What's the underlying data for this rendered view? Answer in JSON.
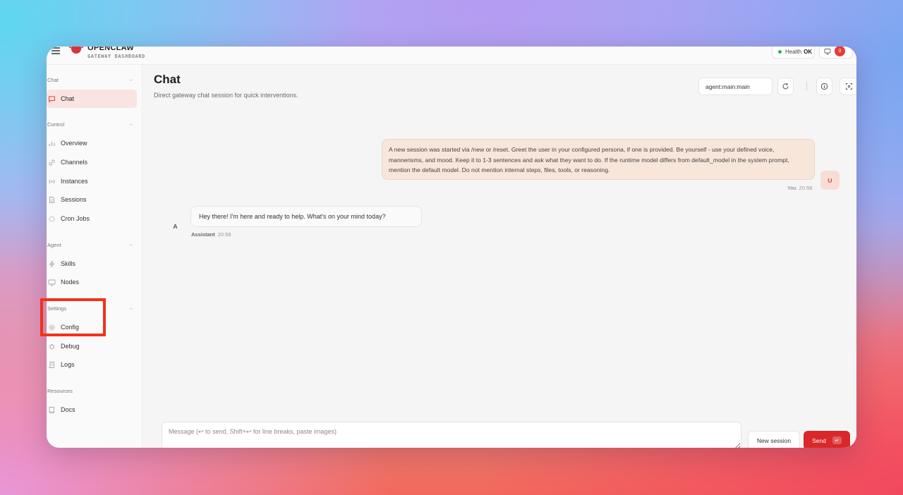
{
  "brand": {
    "title": "OPENCLAW",
    "subtitle": "GATEWAY DASHBOARD"
  },
  "header": {
    "health_label": "Health",
    "health_status": "OK",
    "notification_count": "0"
  },
  "sidebar": {
    "groups": [
      {
        "label": "Chat",
        "items": [
          {
            "label": "Chat",
            "icon": "message-icon",
            "active": true
          }
        ]
      },
      {
        "label": "Control",
        "items": [
          {
            "label": "Overview",
            "icon": "bar-chart-icon"
          },
          {
            "label": "Channels",
            "icon": "link-icon"
          },
          {
            "label": "Instances",
            "icon": "radio-icon"
          },
          {
            "label": "Sessions",
            "icon": "file-icon"
          },
          {
            "label": "Cron Jobs",
            "icon": "loader-icon"
          }
        ]
      },
      {
        "label": "Agent",
        "items": [
          {
            "label": "Skills",
            "icon": "zap-icon"
          },
          {
            "label": "Nodes",
            "icon": "monitor-icon"
          }
        ]
      },
      {
        "label": "Settings",
        "items": [
          {
            "label": "Config",
            "icon": "gear-icon"
          },
          {
            "label": "Debug",
            "icon": "bug-icon"
          },
          {
            "label": "Logs",
            "icon": "scroll-icon"
          }
        ]
      },
      {
        "label": "Resources",
        "items": [
          {
            "label": "Docs",
            "icon": "book-icon"
          }
        ]
      }
    ]
  },
  "main": {
    "title": "Chat",
    "subtitle": "Direct gateway chat session for quick interventions.",
    "session_key": "agent:main:main"
  },
  "messages": {
    "user": {
      "text": "A new session was started via /new or /reset. Greet the user in your configured persona, if one is provided. Be yourself - use your defined voice, mannerisms, and mood. Keep it to 1-3 sentences and ask what they want to do. If the runtime model differs from default_model in the system prompt, mention the default model. Do not mention internal steps, files, tools, or reasoning.",
      "sender": "You",
      "time": "20:58",
      "avatar": "U"
    },
    "assistant": {
      "text": "Hey there! I'm here and ready to help. What's on your mind today?",
      "sender": "Assistant",
      "time": "20:58",
      "avatar": "A"
    }
  },
  "composer": {
    "placeholder": "Message (↩ to send, Shift+↩ for line breaks, paste images)",
    "new_session_label": "New session",
    "send_label": "Send",
    "send_key": "↵"
  },
  "colors": {
    "accent": "#d9282b",
    "active_bg": "#f9e4e1",
    "user_bubble": "#f8e6da",
    "highlight": "#f2311b"
  }
}
